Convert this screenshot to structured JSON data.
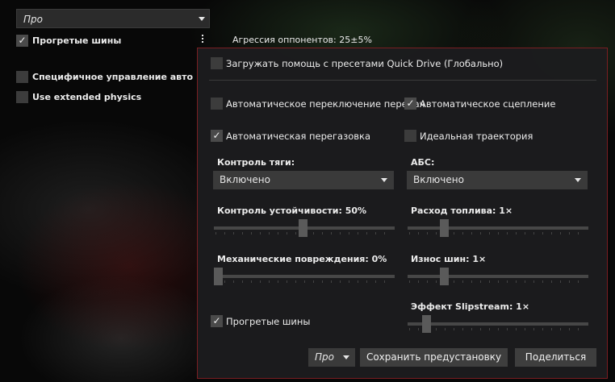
{
  "top": {
    "preset": "Про",
    "warm_tyres_label": "Прогретые шины",
    "ai_aggression": "Агрессия оппонентов: 25±5%",
    "car_specific_label": "Специфичное управление авто",
    "extended_physics_label": "Use extended physics"
  },
  "popup": {
    "qd_assists_label": "Загружать помощь с пресетами Quick Drive (Глобально)",
    "auto_shift_label": "Автоматическое переключение передач",
    "auto_clutch_label": "Автоматическое сцепление",
    "auto_blip_label": "Автоматическая перегазовка",
    "ideal_line_label": "Идеальная траектория",
    "traction_label": "Контроль тяги:",
    "traction_value": "Включено",
    "abs_label": "АБС:",
    "abs_value": "Включено",
    "stability_label": "Контроль устойчивости: 50%",
    "fuel_label": "Расход топлива: 1×",
    "damage_label": "Механические повреждения: 0%",
    "tyre_wear_label": "Износ шин: 1×",
    "slipstream_label": "Эффект Slipstream: 1×",
    "warm_tyres_label": "Прогретые шины",
    "preset_value": "Про",
    "save_label": "Сохранить предустановку",
    "share_label": "Поделиться"
  },
  "state": {
    "warm_tyres": true,
    "car_specific": false,
    "extended_physics": false,
    "qd_assists": false,
    "auto_shift": false,
    "auto_clutch": true,
    "auto_blip": true,
    "ideal_line": false,
    "popup_warm_tyres": true,
    "stability_pct": 50,
    "damage_pct": 0,
    "fuel_rate": 1,
    "tyre_wear_rate": 1,
    "slipstream_rate": 1
  },
  "colors": {
    "popup_border": "#7a1e22",
    "popup_bg": "#1c1c1e",
    "control_bg": "#3a3a3a"
  }
}
